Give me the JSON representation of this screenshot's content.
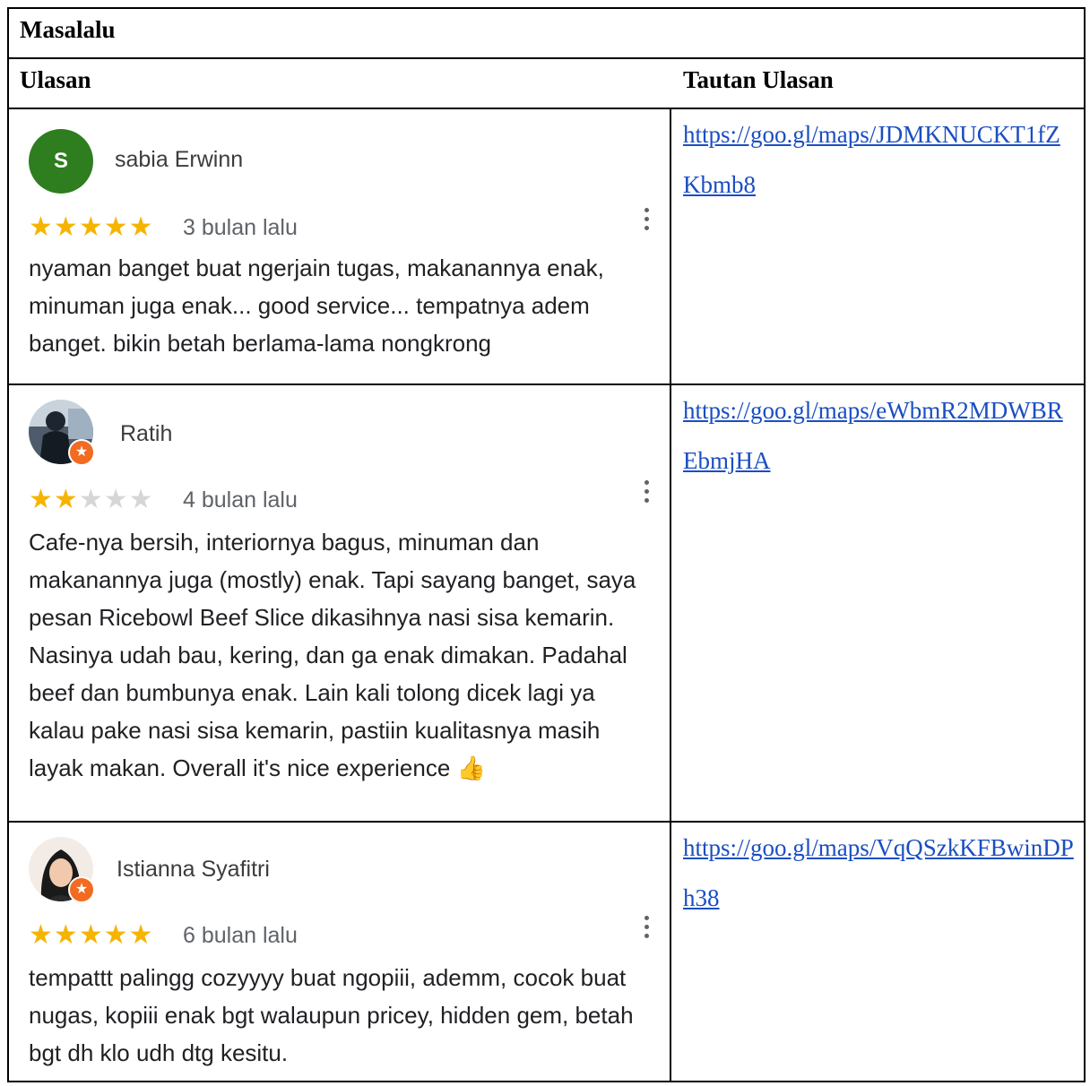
{
  "section_title": "Masalalu",
  "headers": {
    "review": "Ulasan",
    "link": "Tautan Ulasan"
  },
  "reviews": [
    {
      "name": "sabia Erwinn",
      "avatar_letter": "S",
      "rating": 5,
      "date": "3 bulan lalu",
      "text": "nyaman banget buat ngerjain tugas, makanannya enak, minuman juga enak... good service... tempatnya adem banget. bikin betah berlama-lama nongkrong",
      "link": "https://goo.gl/maps/JDMKNUCKT1fZKbmb8"
    },
    {
      "name": "Ratih",
      "rating": 2,
      "date": "4 bulan lalu",
      "text": "Cafe-nya bersih, interiornya bagus, minuman dan makanannya juga (mostly) enak. Tapi sayang banget, saya pesan Ricebowl Beef Slice dikasihnya nasi sisa kemarin. Nasinya udah bau, kering, dan ga enak dimakan. Padahal beef dan bumbunya enak. Lain kali tolong dicek lagi ya kalau pake nasi sisa kemarin, pastiin kualitasnya masih layak makan. Overall it's nice experience 👍",
      "link": "https://goo.gl/maps/eWbmR2MDWBREbmjHA"
    },
    {
      "name": "Istianna Syafitri",
      "rating": 5,
      "date": "6 bulan lalu",
      "text": "tempattt palingg cozyyyy buat ngopiii, ademm, cocok buat nugas, kopiii enak bgt walaupun pricey, hidden gem, betah bgt dh klo udh dtg kesitu.",
      "link": "https://goo.gl/maps/VqQSzkKFBwinDPh38"
    }
  ],
  "icons": {
    "local_guide_badge": "star-badge-icon",
    "menu": "more-vert-icon",
    "star": "star-icon"
  },
  "colors": {
    "star_on": "#f5b400",
    "star_off": "#d6d6d6",
    "link": "#1a4ec2",
    "badge": "#f26b21",
    "avatar_green": "#2e7d1e"
  }
}
